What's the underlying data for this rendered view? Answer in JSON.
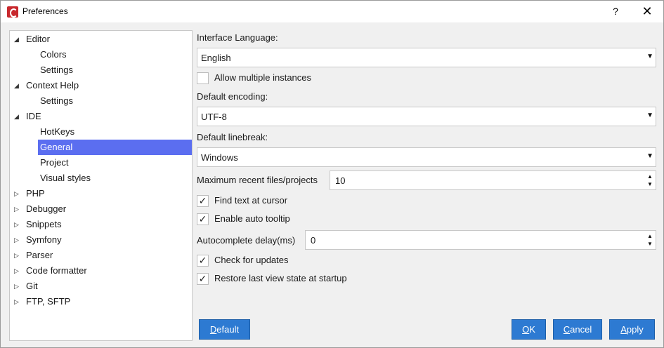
{
  "window": {
    "title": "Preferences",
    "help_label": "?",
    "close_label": "✕"
  },
  "tree": [
    {
      "label": "Editor",
      "type": "parent",
      "expanded": true
    },
    {
      "label": "Colors",
      "type": "child"
    },
    {
      "label": "Settings",
      "type": "child"
    },
    {
      "label": "Context Help",
      "type": "parent",
      "expanded": true
    },
    {
      "label": "Settings",
      "type": "child"
    },
    {
      "label": "IDE",
      "type": "parent",
      "expanded": true
    },
    {
      "label": "HotKeys",
      "type": "child"
    },
    {
      "label": "General",
      "type": "child",
      "selected": true
    },
    {
      "label": "Project",
      "type": "child"
    },
    {
      "label": "Visual styles",
      "type": "child"
    },
    {
      "label": "PHP",
      "type": "parent",
      "expanded": false
    },
    {
      "label": "Debugger",
      "type": "parent",
      "expanded": false
    },
    {
      "label": "Snippets",
      "type": "parent",
      "expanded": false
    },
    {
      "label": "Symfony",
      "type": "parent",
      "expanded": false
    },
    {
      "label": "Parser",
      "type": "parent",
      "expanded": false
    },
    {
      "label": "Code formatter",
      "type": "parent",
      "expanded": false
    },
    {
      "label": "Git",
      "type": "parent",
      "expanded": false
    },
    {
      "label": "FTP, SFTP",
      "type": "parent",
      "expanded": false
    }
  ],
  "form": {
    "interface_language": {
      "label": "Interface Language:",
      "value": "English"
    },
    "allow_multiple": {
      "label": "Allow multiple instances",
      "checked": false
    },
    "default_encoding": {
      "label": "Default encoding:",
      "value": "UTF-8"
    },
    "default_linebreak": {
      "label": "Default linebreak:",
      "value": "Windows"
    },
    "max_recent": {
      "label": "Maximum recent files/projects",
      "value": "10"
    },
    "find_text": {
      "label": "Find text at cursor",
      "checked": true
    },
    "auto_tooltip": {
      "label": "Enable auto tooltip",
      "checked": true
    },
    "autocomplete_delay": {
      "label": "Autocomplete delay(ms)",
      "value": "0"
    },
    "check_updates": {
      "label": "Check for updates",
      "checked": true
    },
    "restore_state": {
      "label": "Restore last view state at startup",
      "checked": true
    }
  },
  "buttons": {
    "default": {
      "mnemonic": "D",
      "rest": "efault"
    },
    "ok": {
      "mnemonic": "O",
      "rest": "K"
    },
    "cancel": {
      "mnemonic": "C",
      "rest": "ancel"
    },
    "apply": {
      "mnemonic": "A",
      "rest": "pply"
    }
  },
  "colors": {
    "selection": "#5b6ef0",
    "button": "#2d7ad2",
    "app_icon": "#c8282d"
  }
}
